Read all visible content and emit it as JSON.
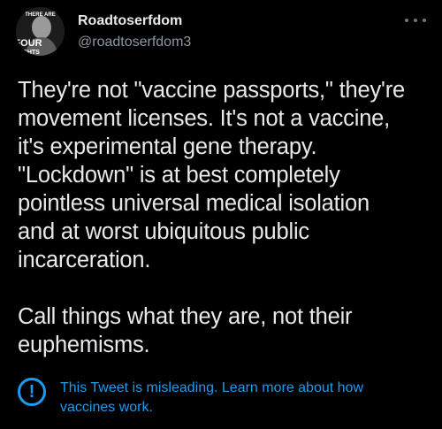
{
  "user": {
    "display_name": "Roadtoserfdom",
    "handle": "@roadtoserfdom3",
    "avatar_text_top": "THERE ARE",
    "avatar_text_mid": "FOUR",
    "avatar_text_bottom": "LIGHTS"
  },
  "tweet": {
    "paragraph1": "They're not \"vaccine passports,\" they're\nmovement licenses. It's not a vaccine,\nit's experimental gene therapy.\n\"Lockdown\" is at best completely\npointless universal medical isolation\nand at worst ubiquitous public\nincarceration.",
    "paragraph2": "Call things what they are, not their\neuphemisms."
  },
  "notice": {
    "icon": "exclamation-circle-icon",
    "text": "This Tweet is misleading. Learn more about how vaccines work."
  },
  "colors": {
    "background": "#000000",
    "text": "#e7e9ea",
    "secondary": "#8b98a5",
    "accent": "#1d9bf0"
  }
}
